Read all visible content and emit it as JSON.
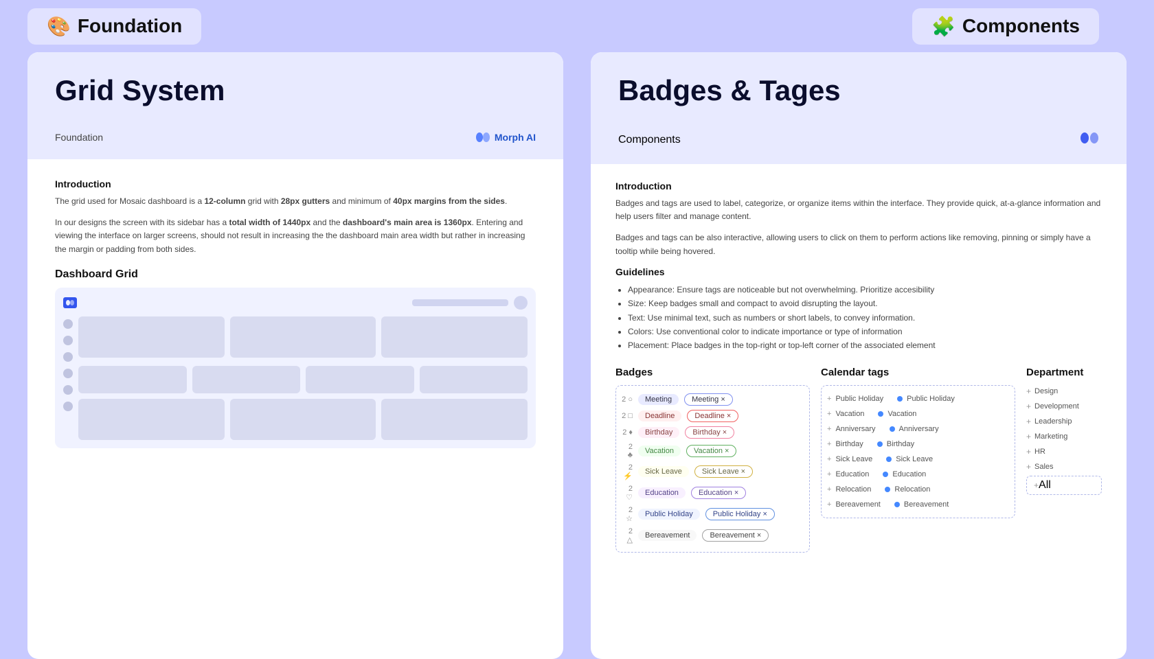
{
  "topbar": {
    "left_icon": "🎨",
    "left_label": "Foundation",
    "right_icon": "🧩",
    "right_label": "Components"
  },
  "left_panel": {
    "header": {
      "title": "Grid System",
      "breadcrumb": "Foundation",
      "morph_label": "Morph AI"
    },
    "intro": {
      "title": "Introduction",
      "text1": "The grid used for Mosaic dashboard is a 12-column grid with 28px gutters and minimum of 40px margins from the sides.",
      "text2_start": "In our designs the screen with its sidebar has a ",
      "text2_bold1": "total width of 1440px",
      "text2_mid": " and the ",
      "text2_bold2": "dashboard's main area is 1360px",
      "text2_end": ". Entering and viewing the interface on larger screens, should not result in increasing the the dashboard main area width but rather in increasing the margin or padding from both sides."
    },
    "sub_title": "Dashboard Grid"
  },
  "right_panel": {
    "header": {
      "title": "Badges & Tages",
      "breadcrumb": "Components"
    },
    "intro": {
      "title": "Introduction",
      "text1": "Badges and tags are used to label, categorize, or organize items within the interface. They provide quick, at-a-glance information and help users filter and manage content.",
      "text2": "Badges and tags can be also interactive, allowing users to click on them to perform actions like removing, pinning or simply have a tooltip while being hovered."
    },
    "guidelines": {
      "title": "Guidelines",
      "items": [
        "Appearance: Ensure tags are noticeable but not overwhelming. Prioritize accesibility",
        "Size: Keep badges small and compact to avoid disrupting the layout.",
        "Text: Use minimal text, such as numbers or short labels, to convey information.",
        "Colors: Use conventional color to indicate importance or type of information",
        "Placement: Place badges in the top-right or top-left corner of the associated element"
      ]
    },
    "badges_col": {
      "title": "Badges",
      "rows": [
        {
          "num": "2",
          "icon_color": "#aab0f0",
          "label": "Meeting",
          "color": "#e8eaff",
          "text_color": "#334"
        },
        {
          "num": "2",
          "icon_color": "#f08080",
          "label": "Deadline",
          "color": "#fff0f0",
          "text_color": "#833"
        },
        {
          "num": "2",
          "icon_color": "#f0a0c0",
          "label": "Birthday",
          "color": "#fff0f8",
          "text_color": "#844"
        },
        {
          "num": "2",
          "icon_color": "#80c080",
          "label": "Vacation",
          "color": "#f0fff0",
          "text_color": "#484"
        },
        {
          "num": "2",
          "icon_color": "#f0d080",
          "label": "Sick Leave",
          "color": "#fffff0",
          "text_color": "#664"
        },
        {
          "num": "2",
          "icon_color": "#c0a0f0",
          "label": "Education",
          "color": "#f8f0ff",
          "text_color": "#548"
        },
        {
          "num": "2",
          "icon_color": "#80b0f0",
          "label": "Public Holiday",
          "color": "#f0f4ff",
          "text_color": "#348"
        },
        {
          "num": "2",
          "icon_color": "#c0c0c0",
          "label": "Bereavement",
          "color": "#f8f8f8",
          "text_color": "#444"
        }
      ]
    },
    "badges_outline_col": {
      "rows": [
        {
          "label": "Meeting",
          "border_color": "#8090f0",
          "text_color": "#334"
        },
        {
          "label": "Deadline",
          "border_color": "#f06060",
          "text_color": "#833"
        },
        {
          "label": "Birthday",
          "border_color": "#f080a0",
          "text_color": "#844"
        },
        {
          "label": "Vacation",
          "border_color": "#60b060",
          "text_color": "#484"
        },
        {
          "label": "Sick Leave",
          "border_color": "#d0b040",
          "text_color": "#664"
        },
        {
          "label": "Education",
          "border_color": "#a080e0",
          "text_color": "#548"
        },
        {
          "label": "Public Holiday",
          "border_color": "#6090e0",
          "text_color": "#348"
        },
        {
          "label": "Bereavement",
          "border_color": "#a0a0a0",
          "text_color": "#444"
        }
      ]
    },
    "calendar_col": {
      "title": "Calendar tags",
      "left": [
        {
          "label": "+ Public Holiday",
          "dot_color": "#aaa"
        },
        {
          "label": "+ Vacation",
          "dot_color": "#aaa"
        },
        {
          "label": "+ Anniversary",
          "dot_color": "#aaa"
        },
        {
          "label": "+ Birthday",
          "dot_color": "#aaa"
        },
        {
          "label": "+ Sick Leave",
          "dot_color": "#aaa"
        },
        {
          "label": "+ Education",
          "dot_color": "#aaa"
        },
        {
          "label": "+ Relocation",
          "dot_color": "#aaa"
        },
        {
          "label": "+ Bereavement",
          "dot_color": "#aaa"
        }
      ],
      "right": [
        {
          "label": "Public Holiday",
          "dot_color": "#4488ff"
        },
        {
          "label": "Vacation",
          "dot_color": "#4488ff"
        },
        {
          "label": "Anniversary",
          "dot_color": "#4488ff"
        },
        {
          "label": "Birthday",
          "dot_color": "#4488ff"
        },
        {
          "label": "Sick Leave",
          "dot_color": "#4488ff"
        },
        {
          "label": "Education",
          "dot_color": "#4488ff"
        },
        {
          "label": "Relocation",
          "dot_color": "#4488ff"
        },
        {
          "label": "Bereavement",
          "dot_color": "#4488ff"
        }
      ]
    },
    "dept_col": {
      "title": "Department",
      "items": [
        "+ Design",
        "+ Development",
        "+ Leadership",
        "+ Marketing",
        "+ HR",
        "+ Sales",
        "+ All"
      ]
    }
  }
}
